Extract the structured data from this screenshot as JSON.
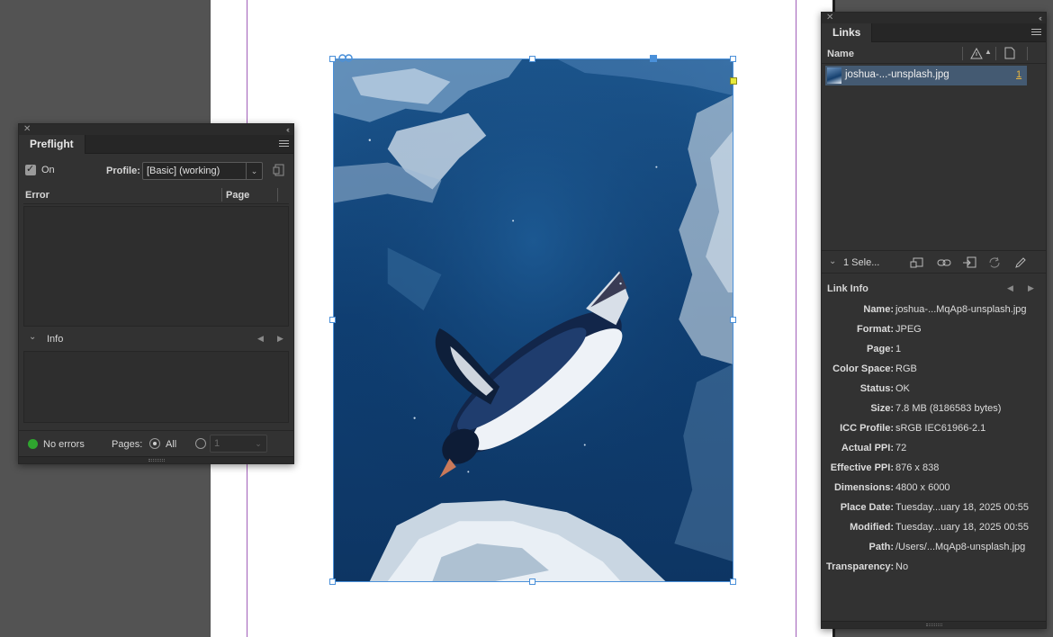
{
  "preflight": {
    "tab": "Preflight",
    "on_label": "On",
    "profile_label": "Profile:",
    "profile_value": "[Basic] (working)",
    "col_error": "Error",
    "col_page": "Page",
    "info_label": "Info",
    "status": "No errors",
    "pages_label": "Pages:",
    "pages_all": "All",
    "pages_range": "1",
    "status_color": "#2fa52f"
  },
  "links": {
    "tab": "Links",
    "col_name": "Name",
    "items": [
      {
        "name": "joshua-...-unsplash.jpg",
        "page": "1"
      }
    ],
    "selection_label": "1 Sele...",
    "link_info_title": "Link Info",
    "info": [
      {
        "key": "Name:",
        "value": "joshua-...MqAp8-unsplash.jpg"
      },
      {
        "key": "Format:",
        "value": "JPEG"
      },
      {
        "key": "Page:",
        "value": "1"
      },
      {
        "key": "Color Space:",
        "value": "RGB"
      },
      {
        "key": "Status:",
        "value": "OK"
      },
      {
        "key": "Size:",
        "value": "7.8 MB (8186583 bytes)"
      },
      {
        "key": "ICC Profile:",
        "value": "sRGB IEC61966-2.1"
      },
      {
        "key": "Actual PPI:",
        "value": "72"
      },
      {
        "key": "Effective PPI:",
        "value": "876 x 838"
      },
      {
        "key": "Dimensions:",
        "value": "4800 x 6000"
      },
      {
        "key": "Place Date:",
        "value": "Tuesday...uary 18, 2025 00:55"
      },
      {
        "key": "Modified:",
        "value": "Tuesday...uary 18, 2025 00:55"
      },
      {
        "key": "Path:",
        "value": "/Users/...MqAp8-unsplash.jpg"
      },
      {
        "key": "Transparency:",
        "value": "No"
      }
    ]
  },
  "canvas": {
    "image_subject": "penguin swimming underwater",
    "margin_color": "#a15fb8",
    "selection_color": "#4a90d9"
  }
}
